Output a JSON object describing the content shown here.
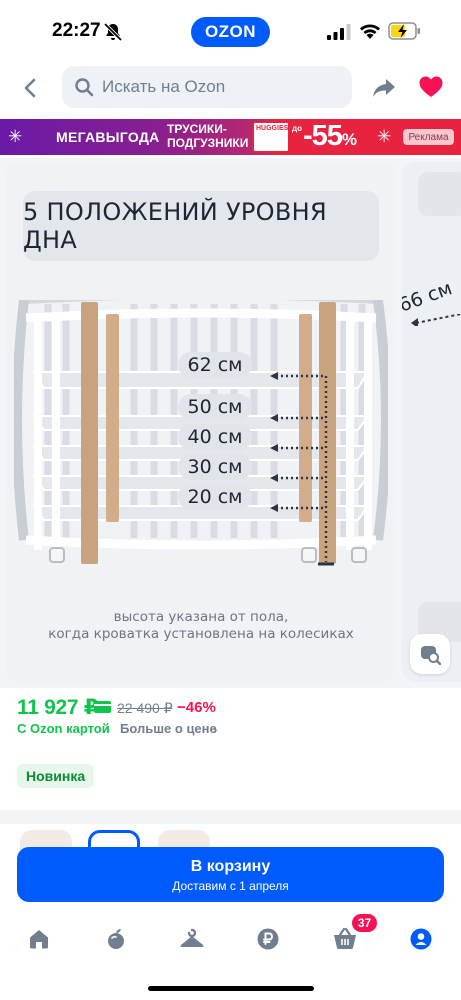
{
  "status_bar": {
    "time": "22:27",
    "center_badge": "OZON",
    "icons": [
      "bell-off-icon",
      "signal-icon",
      "wifi-icon",
      "battery-charging-icon"
    ]
  },
  "header": {
    "search_placeholder": "Искать на Ozon",
    "icons": [
      "back-arrow-icon",
      "search-icon",
      "share-icon",
      "heart-icon"
    ]
  },
  "promo": {
    "title": "МЕГАВЫГОДА",
    "subtitle_line1": "ТРУСИКИ-",
    "subtitle_line2": "ПОДГУЗНИКИ",
    "pack_label": "HUGGIES",
    "prefix": "до",
    "discount": "-55",
    "discount_unit": "%",
    "ad_label": "Реклама"
  },
  "gallery": {
    "slide_title": "5 ПОЛОЖЕНИЙ УРОВНЯ ДНА",
    "heights": [
      "62 см",
      "50 см",
      "40 см",
      "30 см",
      "20 см"
    ],
    "caption_line1": "высота указана от пола,",
    "caption_line2": "когда кроватка установлена на колесиках",
    "next_slide_label": "66 см",
    "lens_icon": "photo-search-icon"
  },
  "price": {
    "current": "11 927 ₽",
    "old": "22 490 ₽",
    "discount": "−46%",
    "card_label": "С Ozon картой",
    "more_label": "Больше о цене",
    "more_chevron": "›",
    "badge": "Новинка"
  },
  "cart": {
    "title": "В корзину",
    "subtitle": "Доставим с 1 апреля"
  },
  "tabbar": {
    "items": [
      "home-icon",
      "fresh-icon",
      "catalog-icon",
      "ruble-icon",
      "cart-icon",
      "profile-icon"
    ],
    "cart_count": "37"
  },
  "colors": {
    "brand": "#005bff",
    "price_green": "#10c44c",
    "discount_pink": "#f91155",
    "badge_bg": "#e5f8ea"
  }
}
